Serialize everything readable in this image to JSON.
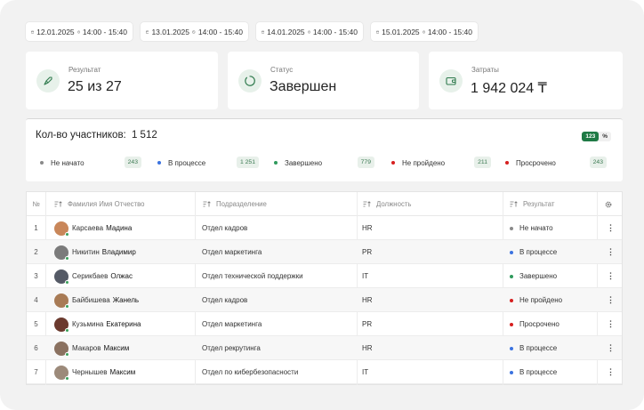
{
  "dates": [
    {
      "date": "12.01.2025",
      "time": "14:00 - 15:40"
    },
    {
      "date": "13.01.2025",
      "time": "14:00 - 15:40"
    },
    {
      "date": "14.01.2025",
      "time": "14:00 - 15:40"
    },
    {
      "date": "15.01.2025",
      "time": "14:00 - 15:40"
    }
  ],
  "cards": {
    "result": {
      "label": "Результат",
      "value": "25 из 27",
      "icon": "rocket-icon"
    },
    "status": {
      "label": "Статус",
      "value": "Завершен",
      "icon": "progress-circle-icon"
    },
    "cost": {
      "label": "Затраты",
      "value": "1 942 024 ₸",
      "icon": "wallet-icon"
    }
  },
  "participants": {
    "title": "Кол-во участников:",
    "total": "1 512",
    "toggle_count": "123",
    "toggle_percent": "%",
    "stats": [
      {
        "label": "Не начато",
        "count": "243",
        "color": "#8a8a8a"
      },
      {
        "label": "В процессе",
        "count": "1 251",
        "color": "#3b73e0"
      },
      {
        "label": "Завершено",
        "count": "779",
        "color": "#2f9a5c"
      },
      {
        "label": "Не пройдено",
        "count": "211",
        "color": "#d61f1f"
      },
      {
        "label": "Просрочено",
        "count": "243",
        "color": "#d61f1f"
      }
    ]
  },
  "table": {
    "headers": {
      "num": "№",
      "name": "Фамилия Имя Отчество",
      "dept": "Подразделение",
      "position": "Должность",
      "result": "Результат"
    },
    "rows": [
      {
        "num": "1",
        "last": "Карсаева",
        "first": "Мадина",
        "dept": "Отдел кадров",
        "position": "HR",
        "result": "Не начато",
        "result_color": "#8a8a8a",
        "avatar_color": "#c9875a"
      },
      {
        "num": "2",
        "last": "Никитин",
        "first": "Владимир",
        "dept": "Отдел маркетинга",
        "position": "PR",
        "result": "В процессе",
        "result_color": "#3b73e0",
        "avatar_color": "#7b7b7b"
      },
      {
        "num": "3",
        "last": "Серикбаев",
        "first": "Олжас",
        "dept": "Отдел технической поддержки",
        "position": "IT",
        "result": "Завершено",
        "result_color": "#2f9a5c",
        "avatar_color": "#555a66"
      },
      {
        "num": "4",
        "last": "Байбишева",
        "first": "Жанель",
        "dept": "Отдел кадров",
        "position": "HR",
        "result": "Не пройдено",
        "result_color": "#d61f1f",
        "avatar_color": "#a87b55"
      },
      {
        "num": "5",
        "last": "Кузьмина",
        "first": "Екатерина",
        "dept": "Отдел маркетинга",
        "position": "PR",
        "result": "Просрочено",
        "result_color": "#d61f1f",
        "avatar_color": "#6b3a2e"
      },
      {
        "num": "6",
        "last": "Макаров",
        "first": "Максим",
        "dept": "Отдел рекрутинга",
        "position": "HR",
        "result": "В процессе",
        "result_color": "#3b73e0",
        "avatar_color": "#8a7160"
      },
      {
        "num": "7",
        "last": "Чернышев",
        "first": "Максим",
        "dept": "Отдел по кибербезопасности",
        "position": "IT",
        "result": "В процессе",
        "result_color": "#3b73e0",
        "avatar_color": "#9c8a7a"
      }
    ]
  },
  "colors": {
    "accent": "#1f7a45",
    "icon_bg": "#e7f1ea",
    "badge_bg": "#e8f0ea"
  }
}
